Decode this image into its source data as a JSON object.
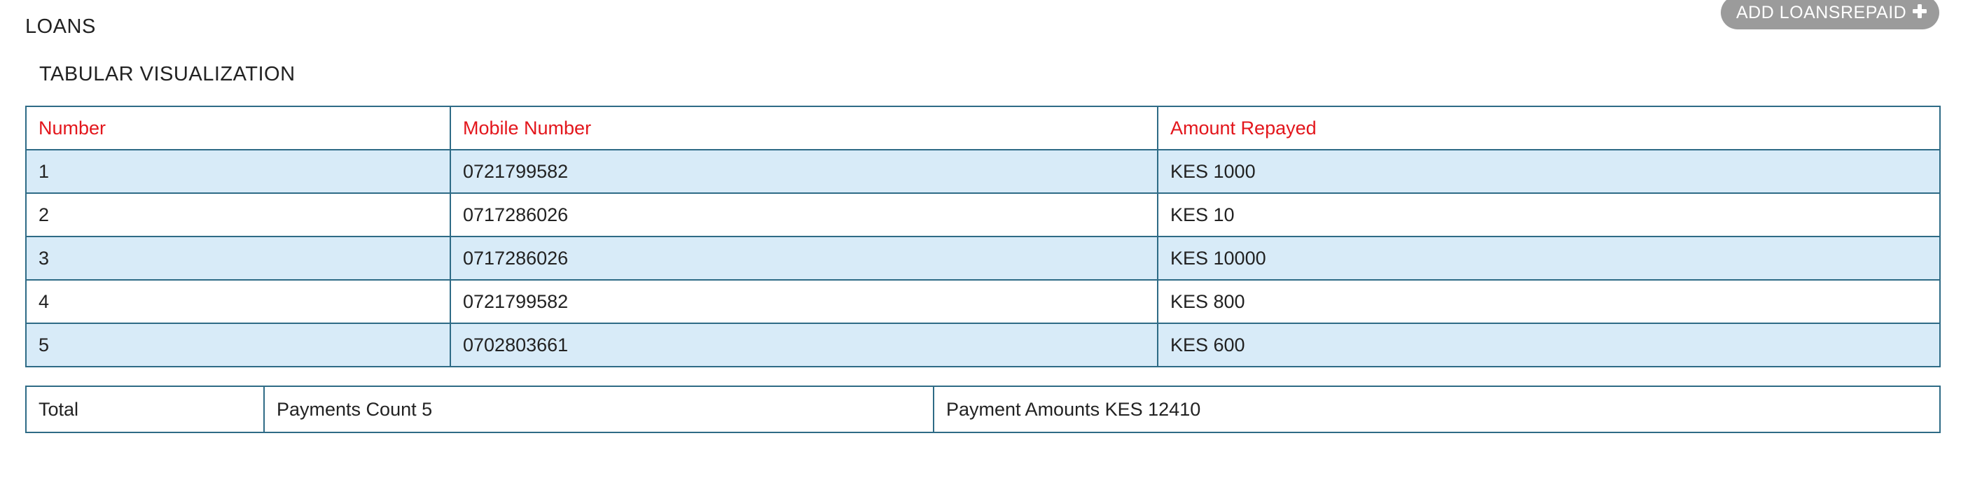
{
  "page": {
    "title": "LOANS",
    "add_button_label": "ADD LOANSREPAID",
    "section_title": "TABULAR VISUALIZATION"
  },
  "icons": {
    "add": "plus-icon"
  },
  "colors": {
    "header_text": "#e3161c",
    "border": "#2e6b86",
    "row_shade": "#d8ebf8",
    "button_bg": "#9b9b9b"
  },
  "table": {
    "columns": [
      "Number",
      "Mobile Number",
      "Amount Repayed"
    ],
    "rows": [
      [
        "1",
        "0721799582",
        "KES 1000"
      ],
      [
        "2",
        "0717286026",
        "KES 10"
      ],
      [
        "3",
        "0717286026",
        "KES 10000"
      ],
      [
        "4",
        "0721799582",
        "KES 800"
      ],
      [
        "5",
        "0702803661",
        "KES 600"
      ]
    ]
  },
  "footer": {
    "total_label": "Total",
    "payments_count": "Payments Count 5",
    "payment_amounts": "Payment Amounts KES 12410"
  }
}
